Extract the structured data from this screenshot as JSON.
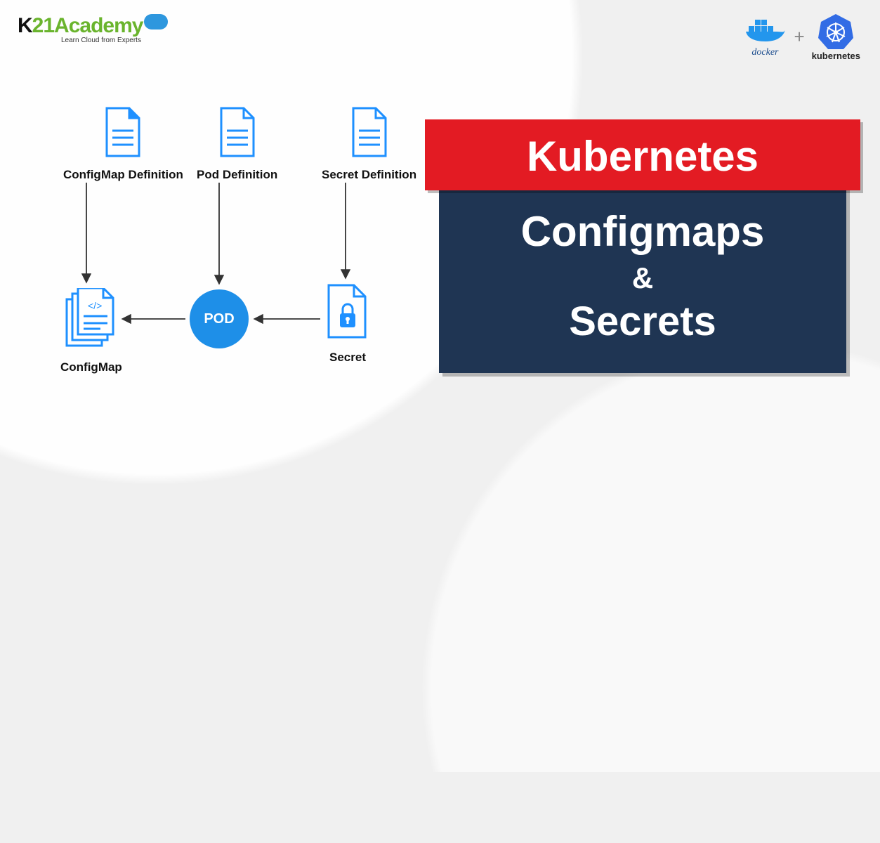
{
  "header": {
    "left": {
      "brand_k": "K",
      "brand_21": "21",
      "brand_academy": "Academy",
      "tagline": "Learn Cloud from Experts"
    },
    "right": {
      "docker_label": "docker",
      "plus": "+",
      "kubernetes_label": "kubernetes"
    }
  },
  "title": {
    "line1": "Kubernetes",
    "line2": "Configmaps",
    "amp": "&",
    "line3": "Secrets"
  },
  "diagram": {
    "top": {
      "configmap_def": "ConfigMap Definition",
      "pod_def": "Pod Definition",
      "secret_def": "Secret Definition"
    },
    "bottom": {
      "configmap": "ConfigMap",
      "pod": "POD",
      "secret": "Secret"
    }
  },
  "colors": {
    "red": "#e31b23",
    "navy": "#1f3553",
    "blue": "#1e90ff",
    "green": "#6ab42d"
  }
}
